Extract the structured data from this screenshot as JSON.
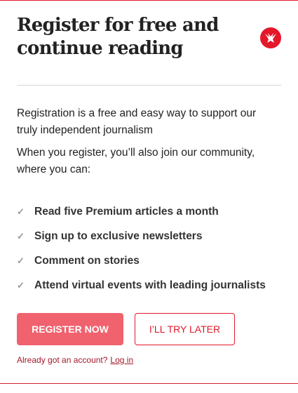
{
  "title": "Register for free and continue reading",
  "logo_icon": "eagle-logo-icon",
  "paragraphs": [
    "Registration is a free and easy way to support our truly independent journalism",
    "When you register, you’ll also join our community, where you can:"
  ],
  "benefits": [
    "Read five Premium articles a month",
    "Sign up to exclusive newsletters",
    "Comment on stories",
    "Attend virtual events with leading journalists"
  ],
  "buttons": {
    "register": "REGISTER NOW",
    "later": "I’LL TRY LATER"
  },
  "login": {
    "prompt": "Already got an account?",
    "link": "Log in"
  },
  "colors": {
    "accent": "#e4172b",
    "primary_button": "#f0626e"
  }
}
